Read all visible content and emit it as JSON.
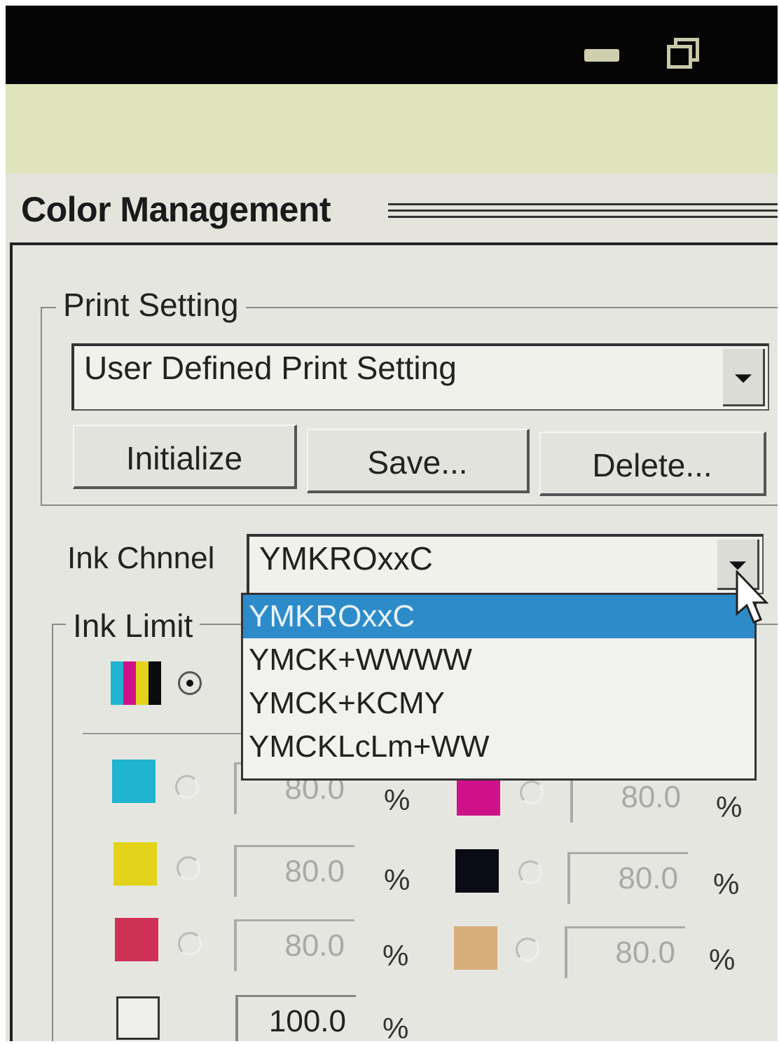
{
  "window": {
    "title": "Color Management"
  },
  "print_setting": {
    "group_label": "Print Setting",
    "selected": "User Defined Print Setting",
    "buttons": {
      "initialize": "Initialize",
      "save": "Save...",
      "delete": "Delete..."
    }
  },
  "ink_channel": {
    "label": "Ink Chnnel",
    "selected": "YMKROxxC",
    "options": [
      "YMKROxxC",
      "YMCK+WWWW",
      "YMCK+KCMY",
      "YMCKLcLm+WW"
    ],
    "highlighted_index": 0
  },
  "ink_limit": {
    "group_label": "Ink Limit",
    "unit": "%",
    "channels": [
      {
        "icon": "cyan-swatch",
        "color": "#1fb4cf",
        "value": "80.0"
      },
      {
        "icon": "magenta-swatch",
        "color": "#d0128a",
        "value": "80.0"
      },
      {
        "icon": "yellow-swatch",
        "color": "#e3d21a",
        "value": "80.0"
      },
      {
        "icon": "black-swatch",
        "color": "#0b0b16",
        "value": "80.0"
      },
      {
        "icon": "red-swatch",
        "color": "#cf3157",
        "value": "80.0"
      },
      {
        "icon": "orange-swatch",
        "color": "#d6ae7a",
        "value": "80.0"
      },
      {
        "icon": "white-swatch",
        "color": "#eeeeea",
        "value": "100.0"
      }
    ]
  }
}
